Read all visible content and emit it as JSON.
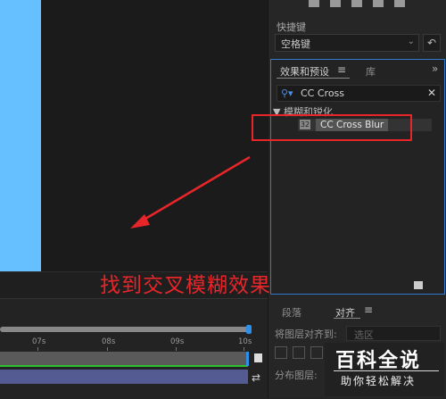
{
  "shortcut": {
    "label": "快捷键",
    "value": "空格键"
  },
  "effects_panel": {
    "tab_effects": "效果和预设",
    "tab_library": "库",
    "search_value": "CC Cross",
    "category": "▼ 模糊和锐化",
    "effect_name": "CC Cross Blur"
  },
  "annotation": {
    "caption": "找到交叉模糊效果",
    "color": "#e8262a"
  },
  "timeline": {
    "ticks": [
      "07s",
      "08s",
      "09s",
      "10s"
    ]
  },
  "align_panel": {
    "tab_paragraph": "段落",
    "tab_align": "对齐",
    "align_to_label": "将图层对齐到:",
    "align_to_value": "选区",
    "distribute_label": "分布图层:"
  },
  "watermark": {
    "title": "百科全说",
    "subtitle": "助你轻松解决"
  },
  "colors": {
    "canvas": "#66c0ff",
    "accent": "#2f7ad0",
    "track_green": "#2ec02e",
    "track_purple": "#545a92"
  }
}
